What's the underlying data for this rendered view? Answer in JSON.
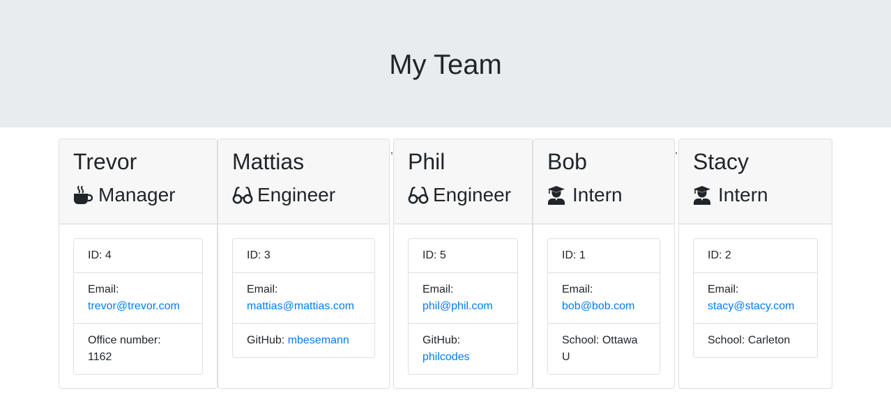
{
  "header": {
    "title": "My Team"
  },
  "team": [
    {
      "name": "Trevor",
      "role": "Manager",
      "role_icon": "coffee-icon",
      "id_text": "ID: 4",
      "email_label": "Email:",
      "email": "trevor@trevor.com",
      "extra_label": "Office number:",
      "extra_value": "1162",
      "extra_is_link": false
    },
    {
      "name": "Mattias",
      "role": "Engineer",
      "role_icon": "glasses-icon",
      "id_text": "ID: 3",
      "email_label": "Email:",
      "email": "mattias@mattias.com",
      "extra_label": "GitHub:",
      "extra_value": "mbesemann",
      "extra_is_link": true
    },
    {
      "name": "Phil",
      "role": "Engineer",
      "role_icon": "glasses-icon",
      "id_text": "ID: 5",
      "email_label": "Email:",
      "email": "phil@phil.com",
      "extra_label": "GitHub:",
      "extra_value": "philcodes",
      "extra_is_link": true
    },
    {
      "name": "Bob",
      "role": "Intern",
      "role_icon": "graduate-icon",
      "id_text": "ID: 1",
      "email_label": "Email:",
      "email": "bob@bob.com",
      "extra_label": "School:",
      "extra_value": "Ottawa U",
      "extra_is_link": false
    },
    {
      "name": "Stacy",
      "role": "Intern",
      "role_icon": "graduate-icon",
      "id_text": "ID: 2",
      "email_label": "Email:",
      "email": "stacy@stacy.com",
      "extra_label": "School:",
      "extra_value": "Carleton",
      "extra_is_link": false
    }
  ],
  "stray_marks": [
    ",",
    ","
  ],
  "colors": {
    "header_bg": "#e9ecef",
    "link": "#007bff",
    "card_head_bg": "#f7f7f7"
  }
}
